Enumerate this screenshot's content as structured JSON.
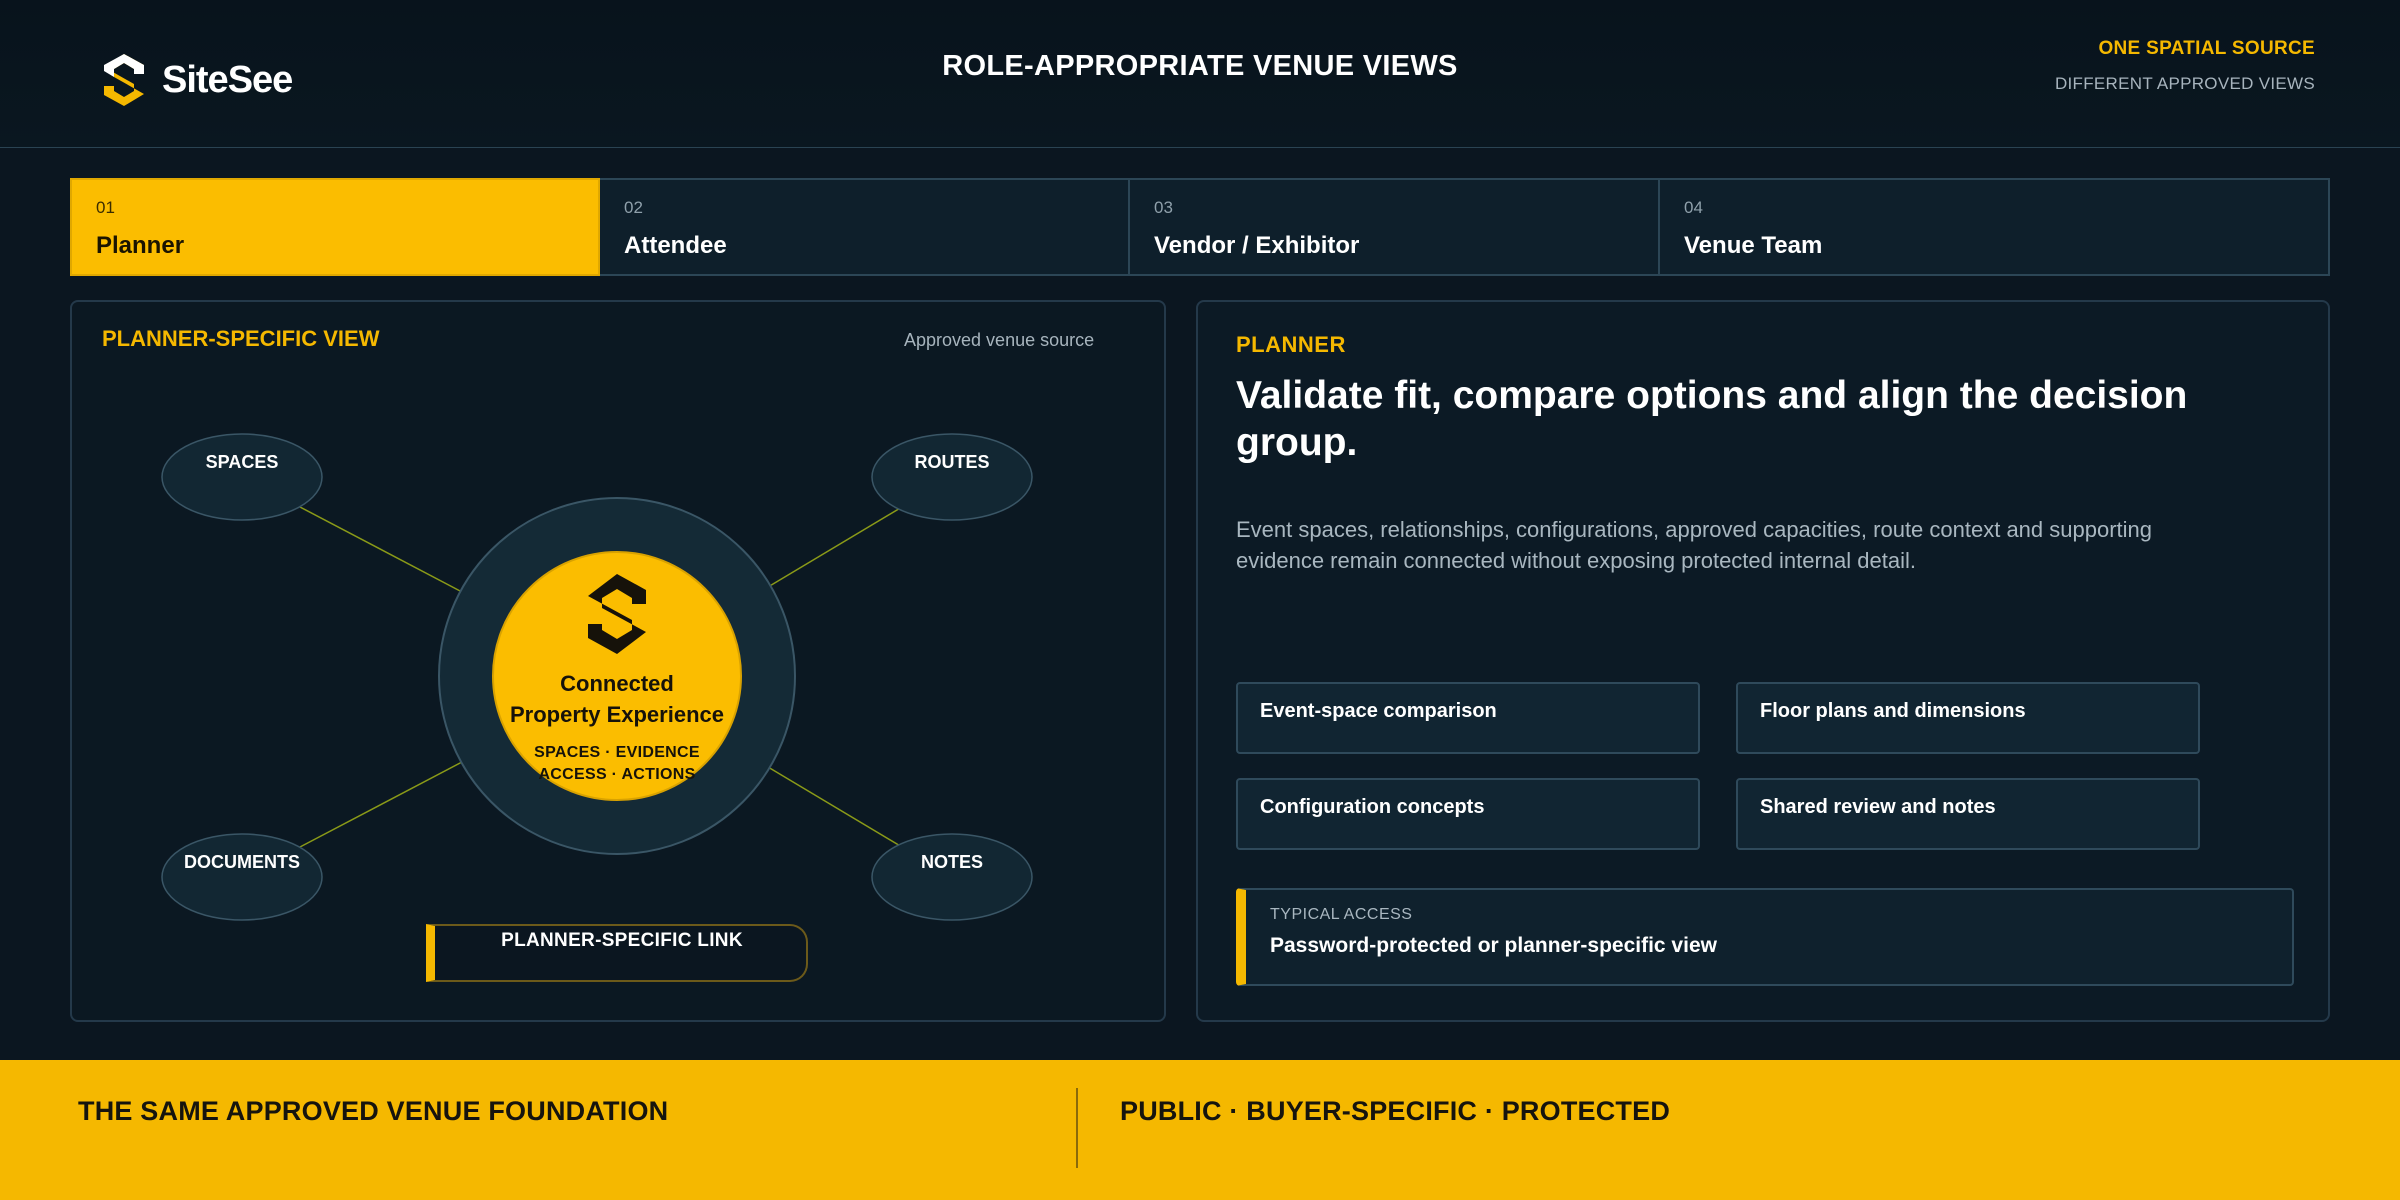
{
  "header": {
    "logo_text": "SiteSee",
    "title": "ROLE-APPROPRIATE VENUE VIEWS",
    "right_primary": "ONE SPATIAL SOURCE",
    "right_secondary": "DIFFERENT APPROVED VIEWS"
  },
  "tabs": [
    {
      "num": "01",
      "label": "Planner",
      "active": true
    },
    {
      "num": "02",
      "label": "Attendee",
      "active": false
    },
    {
      "num": "03",
      "label": "Vendor / Exhibitor",
      "active": false
    },
    {
      "num": "04",
      "label": "Venue Team",
      "active": false
    }
  ],
  "left_panel": {
    "title": "PLANNER-SPECIFIC VIEW",
    "source": "Approved venue source",
    "nodes": {
      "spaces": "SPACES",
      "routes": "ROUTES",
      "documents": "DOCUMENTS",
      "notes": "NOTES"
    },
    "center": {
      "title_line1": "Connected",
      "title_line2": "Property Experience",
      "sub_line1": "SPACES · EVIDENCE",
      "sub_line2": "ACCESS · ACTIONS"
    },
    "link": "PLANNER-SPECIFIC LINK"
  },
  "right_panel": {
    "eyebrow": "PLANNER",
    "heading": "Validate fit, compare options and align the decision group.",
    "description": "Event spaces, relationships, configurations, approved capacities, route context and supporting evidence remain connected without exposing protected internal detail.",
    "features": [
      "Event-space comparison",
      "Floor plans and dimensions",
      "Configuration concepts",
      "Shared review and notes"
    ],
    "access_label": "TYPICAL ACCESS",
    "access_value": "Password-protected or planner-specific view"
  },
  "footer": {
    "left": "THE SAME APPROVED VENUE FOUNDATION",
    "right": "PUBLIC · BUYER-SPECIFIC · PROTECTED"
  },
  "colors": {
    "accent": "#f5b800",
    "background": "#0b1620",
    "panel": "#0c1a25",
    "border": "#24394a"
  },
  "icons": [
    "sitesee-logo-icon"
  ]
}
